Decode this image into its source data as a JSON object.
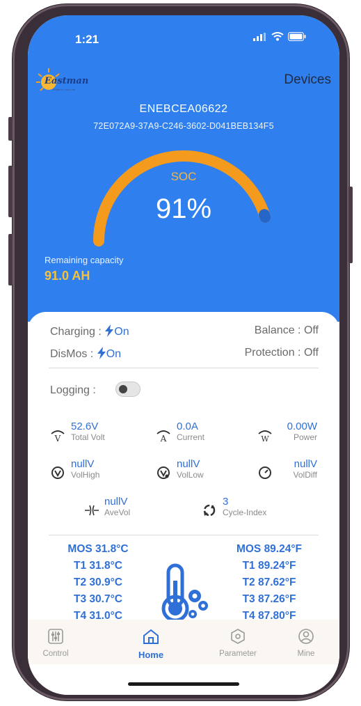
{
  "status_bar": {
    "time": "1:21"
  },
  "header": {
    "logo_text": "Eastman",
    "logo_tagline": "Power in Your Life",
    "devices_label": "Devices",
    "device_name": "ENEBCEA06622",
    "device_uuid": "72E072A9-37A9-C246-3602-D041BEB134F5"
  },
  "gauge": {
    "label": "SOC",
    "value_text": "91%",
    "level_percent": 91,
    "colors": {
      "track": "#f49a1d",
      "fill": "#2666c8"
    }
  },
  "remaining": {
    "label": "Remaining capacity",
    "value": "91.0 AH"
  },
  "status": {
    "charging_label": "Charging :",
    "charging_value": "On",
    "balance_label": "Balance :",
    "balance_value": "Off",
    "dismos_label": "DisMos :",
    "dismos_value": "On",
    "protection_label": "Protection :",
    "protection_value": "Off"
  },
  "logging": {
    "label": "Logging :",
    "enabled": false
  },
  "metrics": [
    {
      "icon": "volt-gauge-icon",
      "value": "52.6V",
      "label": "Total Volt"
    },
    {
      "icon": "ampere-gauge-icon",
      "value": "0.0A",
      "label": "Current"
    },
    {
      "icon": "watt-gauge-icon",
      "value": "0.00W",
      "label": "Power"
    },
    {
      "icon": "vol-high-icon",
      "value": "nullV",
      "label": "VolHigh"
    },
    {
      "icon": "vol-low-icon",
      "value": "nullV",
      "label": "VolLow"
    },
    {
      "icon": "vol-diff-icon",
      "value": "nullV",
      "label": "VolDiff"
    },
    {
      "icon": "ave-vol-icon",
      "value": "nullV",
      "label": "AveVol"
    },
    {
      "icon": "cycle-index-icon",
      "value": "3",
      "label": "Cycle-Index"
    }
  ],
  "temperatures_c": [
    "MOS 31.8°C",
    "T1 31.8°C",
    "T2 30.9°C",
    "T3 30.7°C",
    "T4 31.0°C"
  ],
  "temperatures_f": [
    "MOS 89.24°F",
    "T1 89.24°F",
    "T2 87.62°F",
    "T3 87.26°F",
    "T4 87.80°F"
  ],
  "tabs": [
    {
      "label": "Control",
      "icon": "sliders-icon"
    },
    {
      "label": "Home",
      "icon": "home-icon",
      "active": true
    },
    {
      "label": "Parameter",
      "icon": "hexagon-icon"
    },
    {
      "label": "Mine",
      "icon": "user-icon"
    }
  ],
  "colors": {
    "header_blue": "#2f80ee",
    "accent_blue": "#2f6fd8",
    "soc_label": "#f4b544",
    "capacity": "#f5c23a"
  }
}
